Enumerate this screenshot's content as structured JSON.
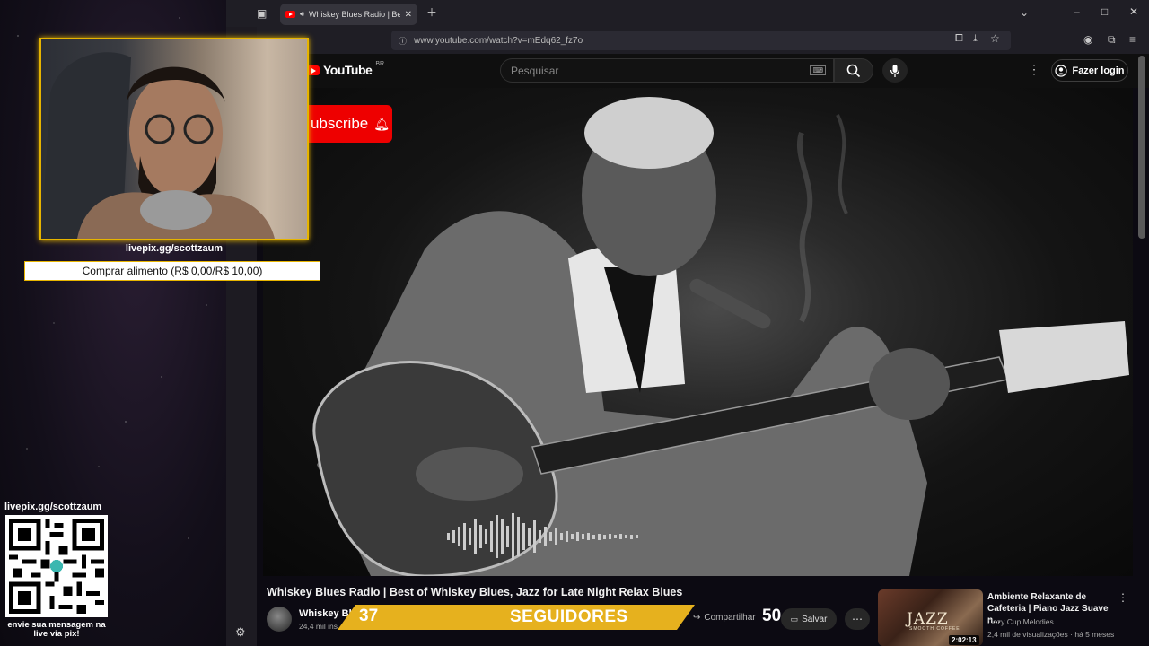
{
  "browser": {
    "tab_title": "Whiskey Blues Radio | Best",
    "url": "www.youtube.com/watch?v=mEdq62_fz7o"
  },
  "youtube": {
    "logo_text": "YouTube",
    "country_code": "BR",
    "search_placeholder": "Pesquisar",
    "login_label": "Fazer login",
    "subscribe_label": "ubscribe"
  },
  "video": {
    "title": "Whiskey Blues Radio | Best of Whiskey Blues, Jazz for Late Night Relax Blues",
    "channel_name": "Whiskey Blu",
    "channel_subs": "24,4 mil ins",
    "share_label": "Compartilhar",
    "save_label": "Salvar"
  },
  "stream_overlay": {
    "livepix_top": "livepix.gg/scottzaum",
    "buy_food": "Comprar alimento (R$ 0,00/R$ 10,00)",
    "qr_title": "livepix.gg/scottzaum",
    "qr_message_line1": "envie sua mensagem na",
    "qr_message_line2": "live via pix!",
    "followers_count": "37",
    "followers_label": "SEGUIDORES",
    "followers_goal": "50"
  },
  "recommended": {
    "title": "Ambiente Relaxante de Cafeteria | Piano Jazz Suave n...",
    "channel": "Cozy Cup Melodies",
    "meta": "2,4 mil de visualizações · há 5 meses",
    "duration": "2:02:13",
    "thumb_title": "JAZZ",
    "thumb_subtitle": "SMOOTH COFFEE"
  },
  "colors": {
    "accent_gold": "#e6b11e",
    "youtube_red": "#ff0000",
    "background": "#0f0f0f"
  }
}
